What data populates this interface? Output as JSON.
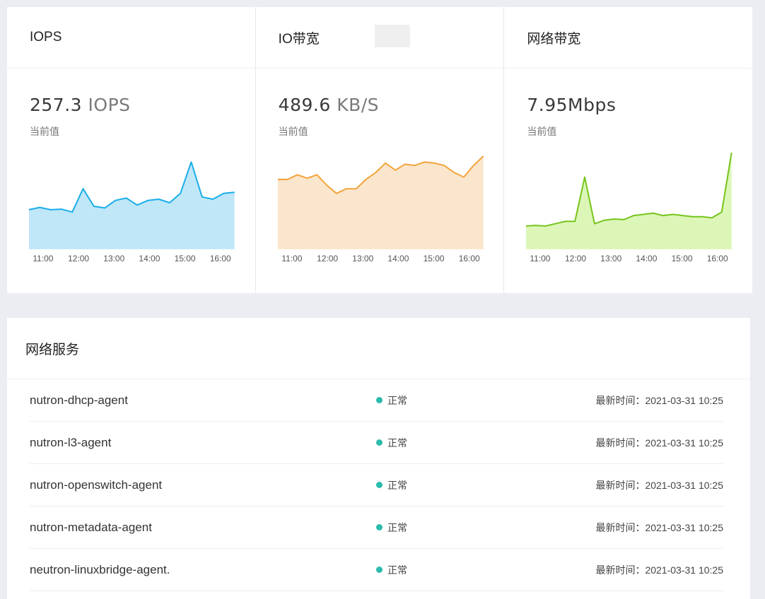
{
  "metrics": [
    {
      "title": "IOPS",
      "value": "257.3",
      "unit": " IOPS",
      "sublabel": "当前值",
      "color": "#1aaee9",
      "fill": "#bfe7f8",
      "series": [
        34,
        36,
        34,
        34.5,
        32,
        52,
        37,
        35.5,
        42,
        44,
        38,
        42,
        43,
        40,
        48,
        75,
        45,
        43,
        48,
        49
      ],
      "ymax": 100,
      "xticks": [
        "11:00",
        "12:00",
        "13:00",
        "14:00",
        "15:00",
        "16:00"
      ]
    },
    {
      "title": "IO带宽",
      "value": "489.6",
      "unit": " KB/S",
      "sublabel": "当前值",
      "color": "#f3a33b",
      "fill": "#fae6cc",
      "series": [
        60,
        60,
        64,
        61,
        64,
        55,
        48,
        52,
        52,
        60,
        66,
        74,
        68,
        73,
        72,
        75,
        74,
        72,
        66,
        62,
        72,
        80
      ],
      "ymax": 100,
      "xticks": [
        "11:00",
        "12:00",
        "13:00",
        "14:00",
        "15:00",
        "16:00"
      ]
    },
    {
      "title": "网络带宽",
      "value": "7.95Mbps",
      "unit": "",
      "sublabel": "当前值",
      "color": "#76c51b",
      "fill": "#dcf6b8",
      "series": [
        20,
        20.5,
        20,
        22,
        24,
        24,
        62,
        22,
        25,
        26,
        25.5,
        29,
        30,
        31,
        29,
        30,
        29,
        28,
        28,
        27,
        32,
        83
      ],
      "ymax": 100,
      "xticks": [
        "11:00",
        "12:00",
        "13:00",
        "14:00",
        "15:00",
        "16:00"
      ]
    }
  ],
  "services": {
    "title": "网络服务",
    "rows": [
      {
        "name": "nutron-dhcp-agent",
        "status": "正常",
        "time": "最新时间：2021-03-31 10:25"
      },
      {
        "name": "nutron-l3-agent",
        "status": "正常",
        "time": "最新时间：2021-03-31 10:25"
      },
      {
        "name": "nutron-openswitch-agent",
        "status": "正常",
        "time": "最新时间：2021-03-31 10:25"
      },
      {
        "name": "nutron-metadata-agent",
        "status": "正常",
        "time": "最新时间：2021-03-31 10:25"
      },
      {
        "name": "neutron-linuxbridge-agent.",
        "status": "正常",
        "time": "最新时间：2021-03-31 10:25"
      }
    ]
  }
}
